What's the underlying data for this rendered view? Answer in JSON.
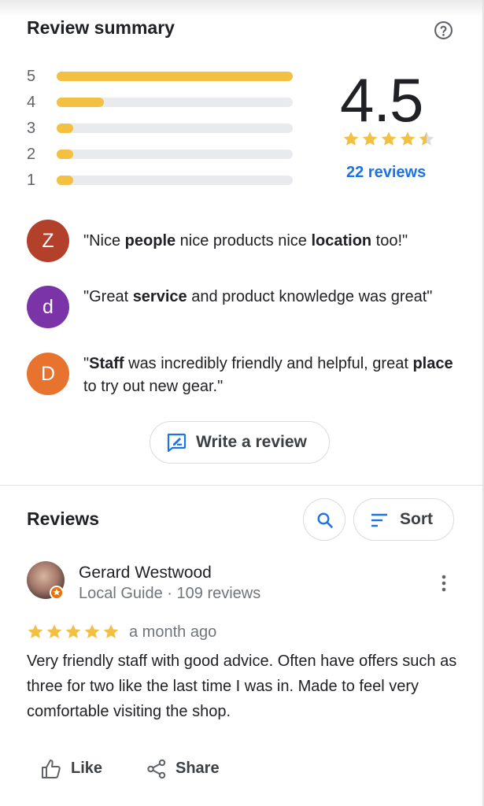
{
  "summary": {
    "title": "Review summary",
    "help_icon": "help-circle-icon",
    "distribution": [
      {
        "stars": "5",
        "fraction": 1.0
      },
      {
        "stars": "4",
        "fraction": 0.2
      },
      {
        "stars": "3",
        "fraction": 0.07
      },
      {
        "stars": "2",
        "fraction": 0.07
      },
      {
        "stars": "1",
        "fraction": 0.07
      }
    ],
    "rating": "4.5",
    "rating_stars_value": 4.5,
    "review_count": "22 reviews",
    "snippets": [
      {
        "initial": "Z",
        "color": "#b2402b",
        "parts": [
          [
            "\"Nice ",
            false
          ],
          [
            "people",
            true
          ],
          [
            " nice products nice ",
            false
          ],
          [
            "location",
            true
          ],
          [
            " too!\"",
            false
          ]
        ]
      },
      {
        "initial": "d",
        "color": "#7b33a8",
        "parts": [
          [
            "\"Great ",
            false
          ],
          [
            "service",
            true
          ],
          [
            " and product knowledge was great\"",
            false
          ]
        ]
      },
      {
        "initial": "D",
        "color": "#e8732f",
        "parts": [
          [
            "\"",
            false
          ],
          [
            "Staff",
            true
          ],
          [
            " was incredibly friendly and helpful, great ",
            false
          ],
          [
            "place",
            true
          ],
          [
            " to try out new gear.\"",
            false
          ]
        ]
      }
    ],
    "write_review": {
      "label": "Write a review",
      "icon": "rate-review-icon"
    }
  },
  "reviews": {
    "title": "Reviews",
    "search_icon": "search-icon",
    "sort_label": "Sort",
    "items": [
      {
        "name": "Gerard Westwood",
        "meta": "Local Guide · 109 reviews",
        "stars": 5,
        "date": "a month ago",
        "text": "Very friendly staff with good advice. Often have offers such as three for two like the last time I was in. Made to feel very comfortable visiting the shop.",
        "like_label": "Like",
        "share_label": "Share"
      }
    ]
  },
  "colors": {
    "accent": "#1a73e8",
    "star": "#f4c042",
    "bar_track": "#e8eaed"
  }
}
